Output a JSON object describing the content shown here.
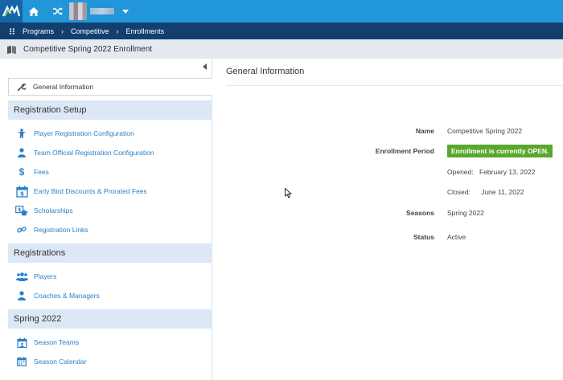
{
  "breadcrumb": [
    "Programs",
    "Competitive",
    "Enrollments"
  ],
  "page_title": "Competitive Spring 2022 Enrollment",
  "sidebar": {
    "general_tab": "General Information",
    "sections": [
      {
        "title": "Registration Setup",
        "items": [
          {
            "label": "Player Registration Configuration",
            "icon": "player-icon"
          },
          {
            "label": "Team Official Registration Configuration",
            "icon": "official-icon"
          },
          {
            "label": "Fees",
            "icon": "dollar-icon"
          },
          {
            "label": "Early Bird Discounts & Prorated Fees",
            "icon": "calendar-discount-icon"
          },
          {
            "label": "Scholarships",
            "icon": "scholarship-icon"
          },
          {
            "label": "Registration Links",
            "icon": "link-icon"
          }
        ]
      },
      {
        "title": "Registrations",
        "items": [
          {
            "label": "Players",
            "icon": "players-group-icon"
          },
          {
            "label": "Coaches & Managers",
            "icon": "coach-icon"
          }
        ]
      },
      {
        "title": "Spring 2022",
        "items": [
          {
            "label": "Season Teams",
            "icon": "teams-icon"
          },
          {
            "label": "Season Calendar",
            "icon": "calendar-icon"
          }
        ]
      }
    ]
  },
  "main": {
    "title": "General Information",
    "fields": {
      "name_label": "Name",
      "name_value": "Competitive Spring 2022",
      "period_label": "Enrollment Period",
      "period_badge": "Enrollment is currently OPEN.",
      "opened_label": "Opened:",
      "opened_value": "February 13, 2022",
      "closed_label": "Closed:",
      "closed_value": "June 11, 2022",
      "seasons_label": "Seasons",
      "seasons_value": "Spring 2022",
      "status_label": "Status",
      "status_value": "Active"
    }
  },
  "colors": {
    "topbar": "#2196d8",
    "breadcrumb_bar": "#123f6e",
    "link": "#2b80c8",
    "open_badge": "#5aa72d"
  }
}
